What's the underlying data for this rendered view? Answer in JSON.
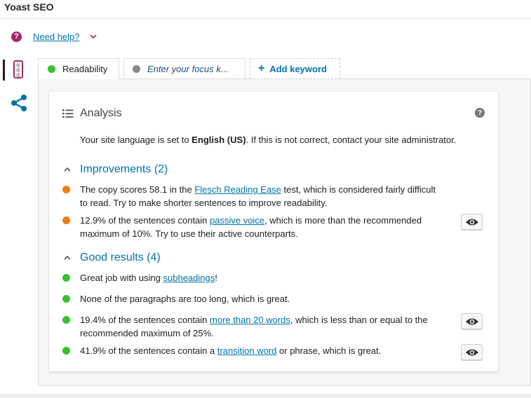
{
  "app": {
    "title": "Yoast SEO"
  },
  "help": {
    "icon_glyph": "?",
    "link": "Need help?"
  },
  "tabs": {
    "readability": "Readability",
    "focus_placeholder": "Enter your focus k...",
    "add_keyword": "Add keyword"
  },
  "analysis": {
    "title": "Analysis",
    "question_glyph": "?",
    "language": {
      "prefix": "Your site language is set to ",
      "lang": "English (US)",
      "suffix": ". If this is not correct, contact your site administrator."
    }
  },
  "improvements": {
    "title": "Improvements (2)",
    "items": [
      {
        "status": "orange",
        "pre": "The copy scores 58.1 in the ",
        "link": "Flesch Reading Ease",
        "post": " test, which is considered fairly difficult to read. Try to make shorter sentences to improve readability.",
        "has_eye": false
      },
      {
        "status": "orange",
        "pre": "12.9% of the sentences contain ",
        "link": "passive voice",
        "post": ", which is more than the recommended maximum of 10%. Try to use their active counterparts.",
        "has_eye": true
      }
    ]
  },
  "good_results": {
    "title": "Good results (4)",
    "items": [
      {
        "status": "green",
        "pre": "Great job with using ",
        "link": "subheadings",
        "post": "!",
        "has_eye": false
      },
      {
        "status": "green",
        "pre": "None of the paragraphs are too long, which is great.",
        "link": "",
        "post": "",
        "has_eye": false
      },
      {
        "status": "green",
        "pre": "19.4% of the sentences contain ",
        "link": "more than 20 words",
        "post": ", which is less than or equal to the recommended maximum of 25%.",
        "has_eye": true
      },
      {
        "status": "green",
        "pre": "41.9% of the sentences contain a ",
        "link": "transition word",
        "post": " or phrase, which is great.",
        "has_eye": true
      }
    ]
  },
  "colors": {
    "brand": "#a4286a",
    "link": "#0073aa",
    "orange": "#ee7c1b",
    "green": "#36c22f"
  },
  "icons": [
    "help-icon",
    "chevron-down-icon",
    "traffic-light-icon",
    "share-icon",
    "list-icon",
    "question-icon",
    "chevron-up-icon",
    "eye-icon",
    "plus-icon"
  ]
}
